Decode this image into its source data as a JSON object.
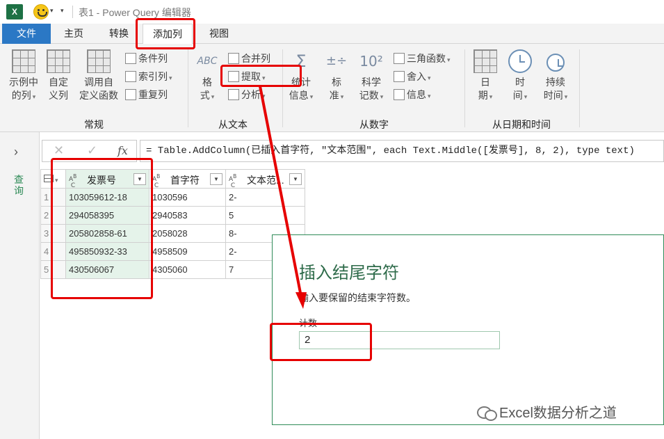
{
  "titlebar": {
    "app_icon": "X",
    "title": "表1 - Power Query 编辑器"
  },
  "tabs": [
    "文件",
    "主页",
    "转换",
    "添加列",
    "视图"
  ],
  "ribbon": {
    "general": {
      "group_label": "常规",
      "example_col": [
        "示例中",
        "的列"
      ],
      "custom_col": [
        "自定",
        "义列"
      ],
      "invoke_fn": [
        "调用自",
        "定义函数"
      ],
      "conditional_col": "条件列",
      "index_col": "索引列",
      "duplicate_col": "重复列"
    },
    "from_text": {
      "group_label": "从文本",
      "format": [
        "格",
        "式"
      ],
      "merge_cols": "合并列",
      "extract": "提取",
      "parse": "分析"
    },
    "from_number": {
      "group_label": "从数字",
      "statistics": [
        "统计",
        "信息"
      ],
      "standard": [
        "标",
        "准"
      ],
      "scientific": [
        "科学",
        "记数"
      ],
      "trig": "三角函数",
      "rounding": "舍入",
      "info": "信息"
    },
    "from_datetime": {
      "group_label": "从日期和时间",
      "date": [
        "日",
        "期"
      ],
      "time": [
        "时",
        "间"
      ],
      "duration": [
        "持续",
        "时间"
      ]
    }
  },
  "query_pane": {
    "label": "查询"
  },
  "formula_bar": {
    "fx": "fx",
    "formula": "= Table.AddColumn(已插入首字符, \"文本范围\", each Text.Middle([发票号], 8, 2), type text)"
  },
  "table": {
    "columns": [
      "发票号",
      "首字符",
      "文本范..."
    ],
    "rows": [
      {
        "num": "1",
        "a": "103059612-18",
        "b": "1030596",
        "c": "2-"
      },
      {
        "num": "2",
        "a": "294058395",
        "b": "2940583",
        "c": "5"
      },
      {
        "num": "3",
        "a": "205802858-61",
        "b": "2058028",
        "c": "8-"
      },
      {
        "num": "4",
        "a": "495850932-33",
        "b": "4958509",
        "c": "2-"
      },
      {
        "num": "5",
        "a": "430506067",
        "b": "4305060",
        "c": "7"
      }
    ]
  },
  "dialog": {
    "title": "插入结尾字符",
    "description": "输入要保留的结束字符数。",
    "count_label": "计数",
    "count_value": "2"
  },
  "watermark": "Excel数据分析之道",
  "colors": {
    "accent_blue": "#2b78c5",
    "dialog_green": "#2e6b4a",
    "annotation_red": "#e60000",
    "selected_col": "#e5f3ea"
  }
}
